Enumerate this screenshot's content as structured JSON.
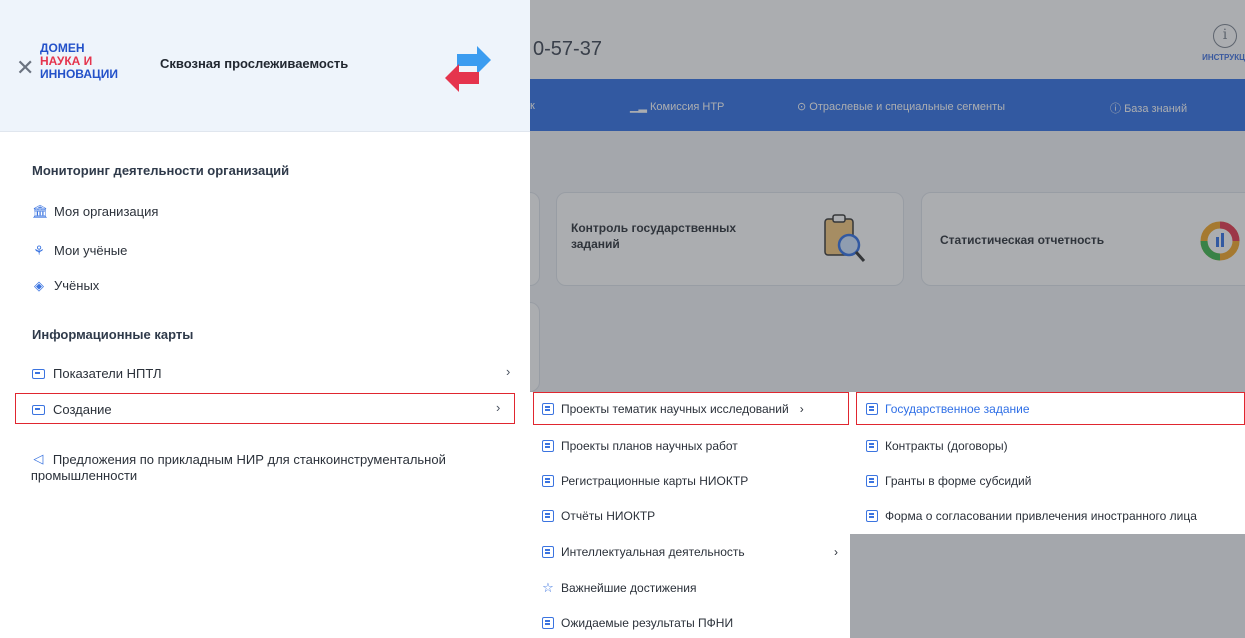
{
  "background": {
    "phone": "0-57-37",
    "info_label": "ИНСТРУКЦ",
    "nav": [
      {
        "label": "к"
      },
      {
        "label": "Комиссия НТР"
      },
      {
        "label": "Отраслевые и специальные сегменты"
      },
      {
        "label": "База знаний"
      }
    ],
    "cards": [
      {
        "title": "Контроль государственных заданий"
      },
      {
        "title": "Статистическая отчетность"
      }
    ]
  },
  "drawer": {
    "logo": {
      "line1": "ДОМЕН",
      "line2": "НАУКА И",
      "line3": "ИННОВАЦИИ"
    },
    "subtitle": "Сквозная прослеживаемость",
    "sections": [
      {
        "title": "Мониторинг деятельности организаций"
      },
      {
        "title": "Информационные карты"
      }
    ],
    "items": [
      {
        "label": "Моя организация",
        "icon": "building-icon"
      },
      {
        "label": "Мои учёные",
        "icon": "users-icon"
      },
      {
        "label": "Учёных",
        "icon": "tag-icon"
      },
      {
        "label": "Показатели НПТЛ",
        "icon": "folder-icon"
      },
      {
        "label": "Создание",
        "icon": "folder-icon"
      },
      {
        "label": "Предложения по прикладным НИР для станкоинструментальной промышленности",
        "icon": "megaphone-icon"
      }
    ]
  },
  "submenu1": [
    {
      "label": "Проекты тематик научных исследований"
    },
    {
      "label": "Проекты планов научных работ"
    },
    {
      "label": "Регистрационные карты НИОКТР"
    },
    {
      "label": "Отчёты НИОКТР"
    },
    {
      "label": "Интеллектуальная деятельность"
    },
    {
      "label": "Важнейшие достижения"
    },
    {
      "label": "Ожидаемые результаты ПФНИ"
    }
  ],
  "submenu2": [
    {
      "label": "Государственное задание"
    },
    {
      "label": "Контракты (договоры)"
    },
    {
      "label": "Гранты в форме субсидий"
    },
    {
      "label": "Форма о согласовании привлечения иностранного лица"
    }
  ],
  "colors": {
    "accent": "#2f6fe6",
    "highlight": "#e0262f",
    "brand_red": "#e5344d"
  }
}
